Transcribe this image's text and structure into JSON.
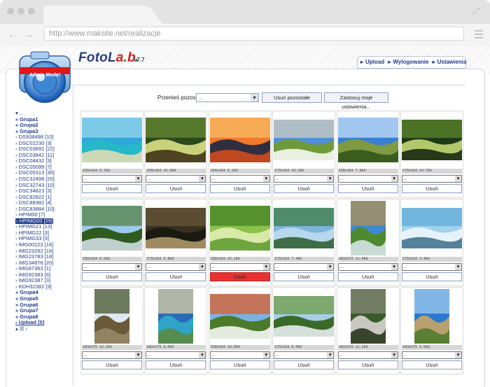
{
  "browser": {
    "url": "http://www.maksite.net/realizacje"
  },
  "app": {
    "logo_a": "FotoL",
    "logo_b": "a",
    "logo_c": ".",
    "logo_d": "b",
    "logo_e": ".",
    "version": "v7.7",
    "badge": "Admin Mode!"
  },
  "topnav": {
    "upload": "Upload",
    "sep1": "▸",
    "logout": "Wylogowanie",
    "sep2": "▸",
    "settings": "Ustawienia",
    "lead": "▸"
  },
  "toolbar": {
    "move_label": "Przenieś pozostałe:",
    "move_value": "..",
    "delete_rest": "Usuń pozostałe",
    "apply": "Zastosuj moje ustawienia..."
  },
  "sidebar": [
    {
      "t": "▾ ..."
    },
    {
      "t": "» Grupa1",
      "g": true
    },
    {
      "t": "» Grupa2",
      "g": true
    },
    {
      "t": "» Grupa3",
      "g": true
    },
    {
      "t": "› DS938498 [10]"
    },
    {
      "t": "› DSC02230 [3]"
    },
    {
      "t": "› DSC03692 [22]"
    },
    {
      "t": "› DSC03842 [11]"
    },
    {
      "t": "› DSC04432 [3]"
    },
    {
      "t": "› DSC05099 [7]"
    },
    {
      "t": "› DSC05313 [30]"
    },
    {
      "t": "› DSC32498 [20]"
    },
    {
      "t": "› DSC32743 [10]"
    },
    {
      "t": "› DSC34823 [3]"
    },
    {
      "t": "› DSC82822 [1]"
    },
    {
      "t": "› DSC88382 [4]"
    },
    {
      "t": "› DSC83884 [10]"
    },
    {
      "t": "› HPIM00 [7]"
    },
    {
      "t": "› HPIMG00 [29]",
      "s": true
    },
    {
      "t": "› HPIMG21 [13]"
    },
    {
      "t": "› HPIMG22 [3]"
    },
    {
      "t": "› HPIMG33 [3]"
    },
    {
      "t": "› IMG00223 [16]"
    },
    {
      "t": "› IMG23292 [18]"
    },
    {
      "t": "› IMG23783 [18]"
    },
    {
      "t": "› IMG34876 [20]"
    },
    {
      "t": "› IMG87363 [1]"
    },
    {
      "t": "› IMG92383 [6]"
    },
    {
      "t": "› IMG92387 [3]"
    },
    {
      "t": "› KDH32382 [3]"
    },
    {
      "t": "» Grupa4",
      "g": true
    },
    {
      "t": "» Grupa5",
      "g": true
    },
    {
      "t": "» Grupa6",
      "g": true
    },
    {
      "t": "» Grupa7",
      "g": true
    },
    {
      "t": "» Grupa8",
      "g": true
    },
    {
      "t": "› Upload [0]",
      "u": true
    },
    {
      "t": "▴ ☰ ›"
    }
  ],
  "photos": [
    {
      "info": "259x194 9.7kb",
      "sel": "..",
      "btn": "Usuń"
    },
    {
      "info": "259x194 10.9kb",
      "sel": "..",
      "btn": "Usuń"
    },
    {
      "info": "264x194 6.1kb",
      "sel": "..",
      "btn": "Usuń"
    },
    {
      "info": "275x183 19.3kb",
      "sel": "..",
      "btn": "Usuń"
    },
    {
      "info": "259x194 7.8kb",
      "sel": "..",
      "btn": "Usuń"
    },
    {
      "info": "275x183 14.7kb",
      "sel": "..",
      "btn": "Usuń"
    },
    {
      "info": "259x194 6.2kb",
      "sel": "..",
      "btn": "Usuń"
    },
    {
      "info": "275x183 5.8kb",
      "sel": "..",
      "btn": "Usuń"
    },
    {
      "info": "259x194 15.1kb",
      "sel": "..",
      "btn": "Usuń",
      "red": true
    },
    {
      "info": "276x183 7.4kb",
      "sel": "..",
      "btn": "Usuń"
    },
    {
      "info": "183x275 11.4kb",
      "sel": "..",
      "btn": "Usuń"
    },
    {
      "info": "275x183 3.4kb",
      "sel": "..",
      "btn": "Usuń"
    },
    {
      "info": "183x275 13.2kb",
      "sel": "..",
      "btn": "Usuń"
    },
    {
      "info": "183x275 8.9kb",
      "sel": "..",
      "btn": "Usuń"
    },
    {
      "info": "259x194 10.9kb",
      "sel": "..",
      "btn": "Usuń"
    },
    {
      "info": "275x183 8.4kb",
      "sel": "..",
      "btn": "Usuń"
    },
    {
      "info": "183x276 11.2kb",
      "sel": "..",
      "btn": "Usuń"
    },
    {
      "info": "183x275 9.5kb",
      "sel": "..",
      "btn": "Usuń"
    }
  ]
}
